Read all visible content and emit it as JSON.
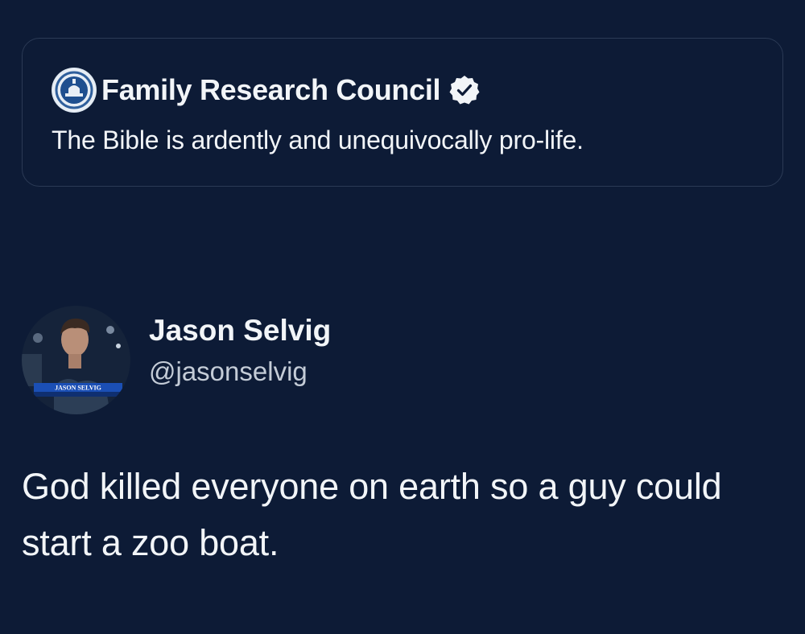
{
  "quoted_tweet": {
    "author_name": "Family Research Council",
    "verified": true,
    "text": "The Bible is ardently and unequivocally pro-life."
  },
  "tweet": {
    "author_name": "Jason Selvig",
    "handle": "@jasonselvig",
    "avatar_caption": "JASON SELVIG",
    "text": "God killed everyone on earth so a guy could start a zoo boat."
  },
  "colors": {
    "background": "#0d1b36",
    "card_border": "#2b3a55",
    "text_primary": "#f2f5f8",
    "text_secondary": "#c4ccd7",
    "verified_badge": "#1d9bf0"
  },
  "icons": {
    "verified": "verified-badge-icon",
    "org_logo": "org-logo-icon"
  }
}
